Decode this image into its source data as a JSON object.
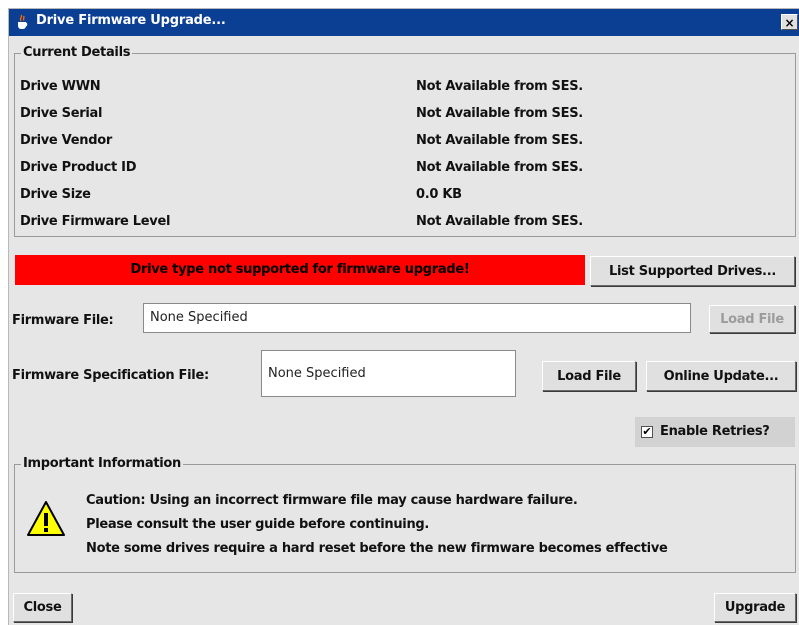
{
  "window": {
    "title": "Drive Firmware Upgrade...",
    "close_symbol": "×",
    "app_icon": "java-cup-icon"
  },
  "current_details": {
    "legend": "Current Details",
    "rows": [
      {
        "label": "Drive WWN",
        "value": "Not Available from SES."
      },
      {
        "label": "Drive Serial",
        "value": "Not Available from SES."
      },
      {
        "label": "Drive Vendor",
        "value": "Not Available from SES."
      },
      {
        "label": "Drive Product ID",
        "value": "Not Available from SES."
      },
      {
        "label": "Drive Size",
        "value": "0.0 KB"
      },
      {
        "label": "Drive Firmware Level",
        "value": "Not Available from SES."
      }
    ]
  },
  "status": {
    "message": "Drive type not supported for firmware upgrade!",
    "color": "#ff0000"
  },
  "buttons": {
    "list_supported": "List Supported Drives...",
    "load_file_firmware": "Load File",
    "load_file_spec": "Load File",
    "online_update": "Online Update...",
    "close": "Close",
    "upgrade": "Upgrade"
  },
  "firmware_file": {
    "label": "Firmware File:",
    "value": "None Specified"
  },
  "spec_file": {
    "label": "Firmware Specification File:",
    "value": "None Specified"
  },
  "retries": {
    "label": "Enable Retries?",
    "checked": true,
    "check_mark": "✔"
  },
  "important_info": {
    "legend": "Important Information",
    "icon": "warning-icon",
    "lines": [
      "Caution: Using an incorrect firmware file may cause hardware failure.",
      "Please consult the user guide before continuing.",
      "Note some drives require a hard reset before the new firmware becomes effective"
    ]
  },
  "colors": {
    "titlebar": "#0b3f94",
    "background": "#e6e6e6",
    "warning_yellow": "#ffff00"
  }
}
